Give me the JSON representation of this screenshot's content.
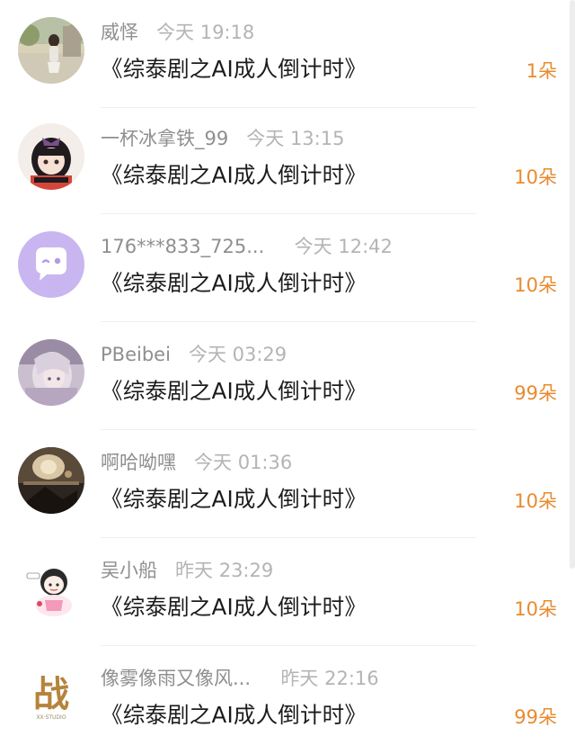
{
  "items": [
    {
      "name": "威怿",
      "time": "今天 19:18",
      "title": "《综泰剧之AI成人倒计时》",
      "count": "1朵",
      "avatar": "photo-girl-avatar"
    },
    {
      "name": "一杯冰拿铁_99",
      "time": "今天 13:15",
      "title": "《综泰剧之AI成人倒计时》",
      "count": "10朵",
      "avatar": "anime-girl-avatar"
    },
    {
      "name": "176***833_725...",
      "time": "今天 12:42",
      "title": "《综泰剧之AI成人倒计时》",
      "count": "10朵",
      "avatar": "default-chat-bubble-avatar"
    },
    {
      "name": "PBeibei",
      "time": "今天 03:29",
      "title": "《综泰剧之AI成人倒计时》",
      "count": "99朵",
      "avatar": "anime-art-avatar"
    },
    {
      "name": "啊哈呦嘿",
      "time": "今天 01:36",
      "title": "《综泰剧之AI成人倒计时》",
      "count": "10朵",
      "avatar": "dark-painting-avatar"
    },
    {
      "name": "吴小船",
      "time": "昨天 23:29",
      "title": "《综泰剧之AI成人倒计时》",
      "count": "10朵",
      "avatar": "chibi-character-avatar"
    },
    {
      "name": "像雾像雨又像风...",
      "time": "昨天 22:16",
      "title": "《综泰剧之AI成人倒计时》",
      "count": "99朵",
      "avatar": "calligraphy-zhan-avatar",
      "avatar_text": "战",
      "avatar_subtext": "XX·STUDIO"
    }
  ],
  "colors": {
    "count": "#e88b2e",
    "title": "#1b1b1b",
    "name": "#8f8f8f",
    "time": "#b4b4b4"
  }
}
